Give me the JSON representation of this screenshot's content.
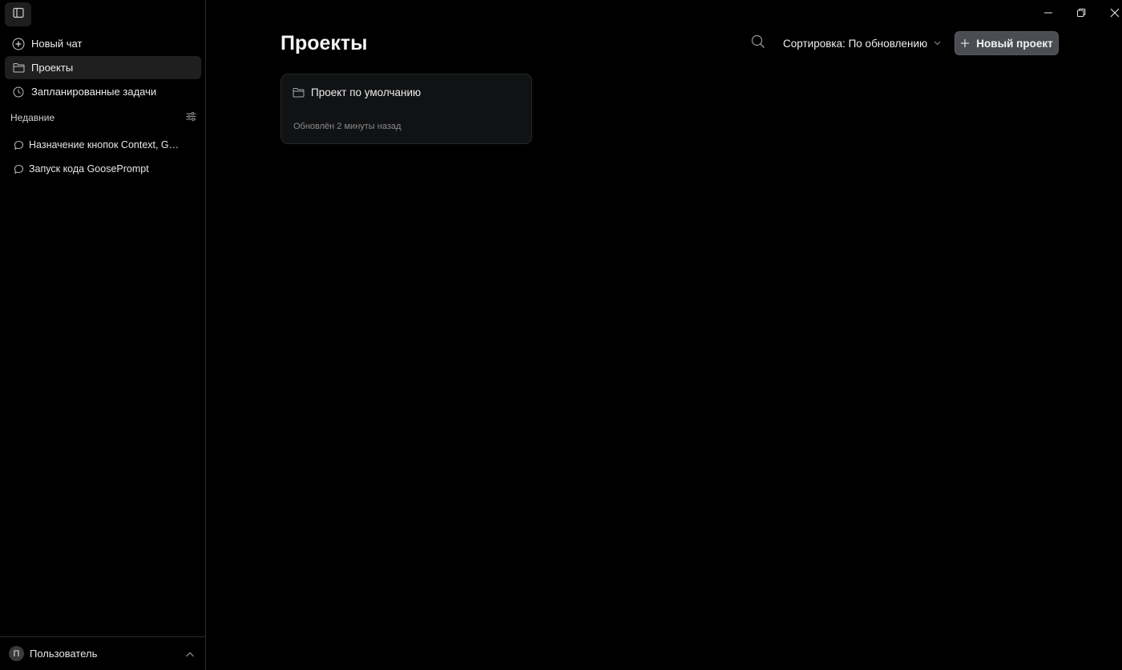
{
  "sidebar": {
    "nav": [
      {
        "label": "Новый чат",
        "icon": "plus-icon"
      },
      {
        "label": "Проекты",
        "icon": "folder-icon",
        "active": true
      },
      {
        "label": "Запланированные задачи",
        "icon": "clock-icon"
      }
    ],
    "recent_heading": "Недавние",
    "recent": [
      {
        "label": "Назначение кнопок Context, Ge...",
        "icon": "chat-bubble-icon"
      },
      {
        "label": "Запуск кода GoosePrompt",
        "icon": "chat-bubble-icon"
      }
    ],
    "user": {
      "initial": "П",
      "name": "Пользователь"
    }
  },
  "main": {
    "title": "Проекты",
    "sort_label": "Сортировка: По обновлению",
    "new_project_label": "Новый проект",
    "projects": [
      {
        "name": "Проект по умолчанию",
        "updated": "Обновлён 2 минуты назад"
      }
    ]
  },
  "colors": {
    "background": "#000000",
    "sidebar_active": "#1f1f1f",
    "card_background": "#111214",
    "primary_button": "#4a4d52"
  }
}
